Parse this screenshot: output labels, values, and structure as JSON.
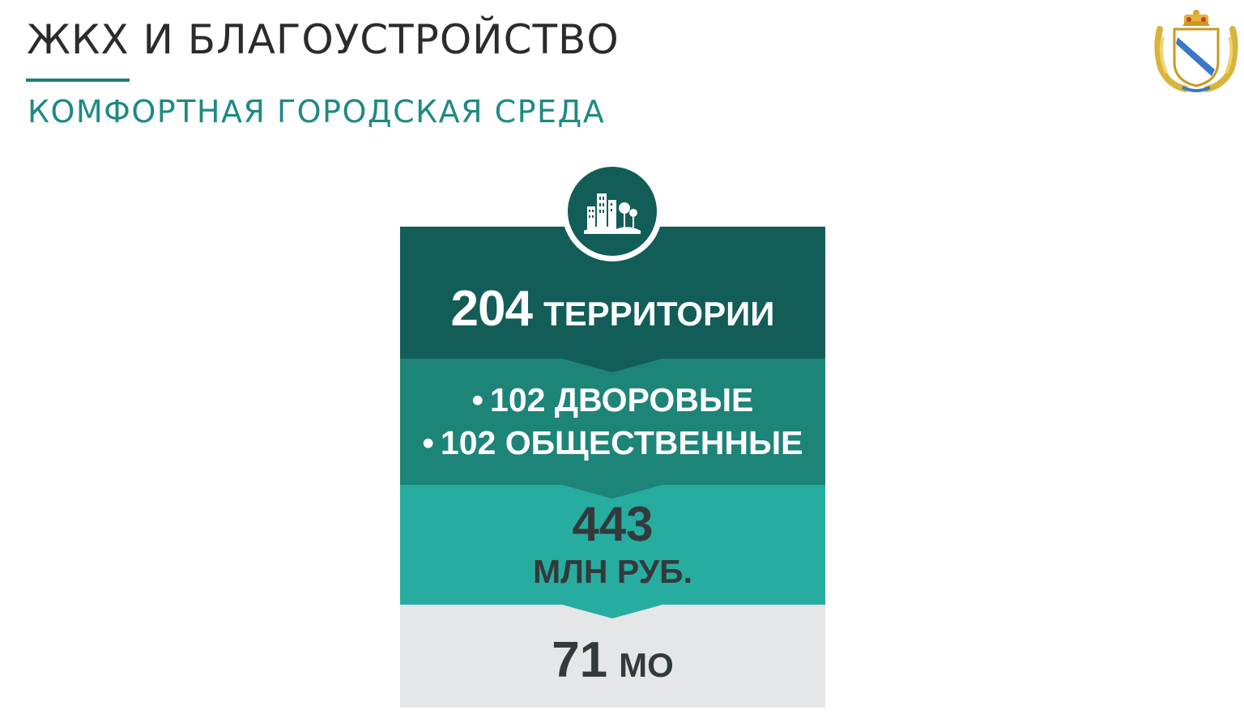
{
  "header": {
    "title": "ЖКХ И БЛАГОУСТРОЙСТВО",
    "subtitle": "КОМФОРТНАЯ ГОРОДСКАЯ СРЕДА"
  },
  "colors": {
    "title": "#2b2b2b",
    "accent": "#1e8a82",
    "block_dark": "#125d57",
    "block_mid": "#1d8478",
    "block_light": "#27ada0",
    "block_gray": "#e4e6e8"
  },
  "icons": {
    "emblem": "coat-of-arms-icon",
    "city": "city-buildings-trees-icon"
  },
  "infographic": {
    "territories": {
      "value": "204",
      "unit": "ТЕРРИТОРИИ"
    },
    "breakdown": [
      {
        "bullet": "•",
        "text": "102 ДВОРОВЫЕ"
      },
      {
        "bullet": "•",
        "text": "102 ОБЩЕСТВЕННЫЕ"
      }
    ],
    "funding": {
      "value": "443",
      "unit": "МЛН РУБ."
    },
    "municipalities": {
      "value": "71",
      "unit": "МО"
    }
  }
}
